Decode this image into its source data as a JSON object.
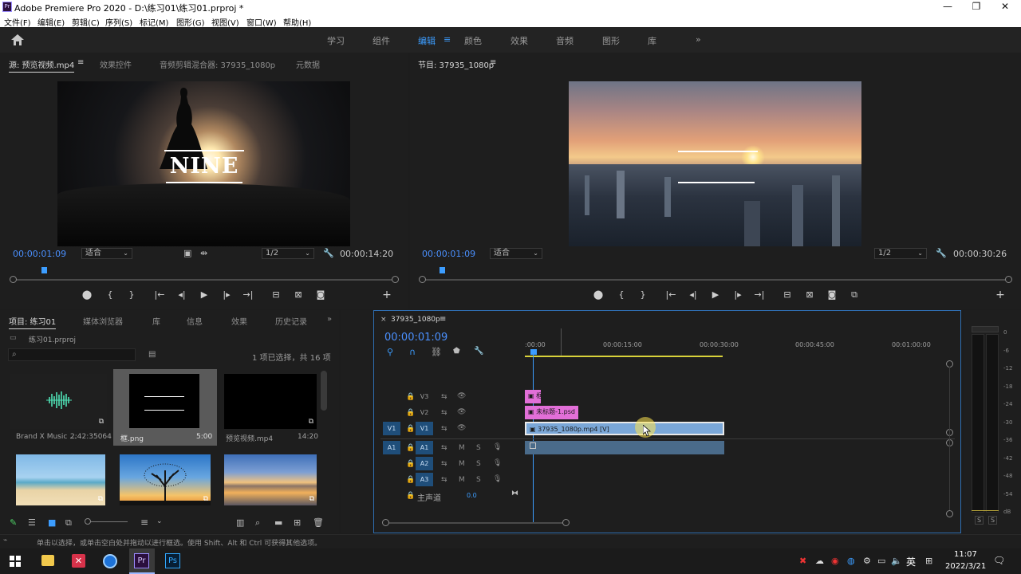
{
  "window": {
    "title": "Adobe Premiere Pro 2020 - D:\\练习01\\练习01.prproj *",
    "logo_text": "Pr",
    "minimize": "—",
    "restore": "❐",
    "close": "✕"
  },
  "menu": [
    "文件(F)",
    "编辑(E)",
    "剪辑(C)",
    "序列(S)",
    "标记(M)",
    "图形(G)",
    "视图(V)",
    "窗口(W)",
    "帮助(H)"
  ],
  "workspaces": {
    "items": [
      "学习",
      "组件",
      "编辑",
      "颜色",
      "效果",
      "音频",
      "图形",
      "库"
    ],
    "active": "编辑",
    "menu_icon": "≡",
    "more": "»"
  },
  "source_panel": {
    "tabs": [
      "源: 预览视频.mp4",
      "效果控件",
      "音频剪辑混合器: 37935_1080p",
      "元数据"
    ],
    "menu_icon": "≡",
    "overlay_text": "NINE",
    "timecode": "00:00:01:09",
    "fit": "适合",
    "resolution": "1/2",
    "duration": "00:00:14:20"
  },
  "program_panel": {
    "tab": "节目: 37935_1080p",
    "menu_icon": "≡",
    "timecode": "00:00:01:09",
    "fit": "适合",
    "resolution": "1/2",
    "duration": "00:00:30:26"
  },
  "transport": {
    "marker": "⬤",
    "in": "{",
    "out": "}",
    "goto_in": "|←",
    "step_back": "◂|",
    "play": "▶",
    "step_fwd": "|▸",
    "goto_out": "→|",
    "insert": "⊟",
    "overwrite": "⊠",
    "export_frame": "◙",
    "compare": "⧉",
    "add": "+"
  },
  "project_panel": {
    "tabs": [
      "项目: 练习01",
      "媒体浏览器",
      "库",
      "信息",
      "效果",
      "历史记录"
    ],
    "project_file": "练习01.prproj",
    "selection_info": "1 项已选择，共 16 项",
    "more": "»",
    "items": [
      {
        "name": "Brand X Music ...",
        "duration": "2:42:35064",
        "kind": "audio"
      },
      {
        "name": "框.png",
        "duration": "5:00",
        "kind": "frame"
      },
      {
        "name": "预览视频.mp4",
        "duration": "14:20",
        "kind": "black"
      },
      {
        "name": "",
        "duration": "",
        "kind": "beach"
      },
      {
        "name": "",
        "duration": "",
        "kind": "tree"
      },
      {
        "name": "",
        "duration": "",
        "kind": "lake"
      }
    ]
  },
  "timeline": {
    "tab": "37935_1080p",
    "close": "×",
    "menu_icon": "≡",
    "timecode": "00:00:01:09",
    "ruler": [
      ":00:00",
      "00:00:15:00",
      "00:00:30:00",
      "00:00:45:00",
      "00:01:00:00"
    ],
    "video_tracks": [
      {
        "name": "V3",
        "source": ""
      },
      {
        "name": "V2",
        "source": ""
      },
      {
        "name": "V1",
        "source": "V1"
      }
    ],
    "audio_tracks": [
      {
        "name": "A1",
        "source": "A1"
      },
      {
        "name": "A2",
        "source": ""
      },
      {
        "name": "A3",
        "source": ""
      }
    ],
    "track_m": "M",
    "track_s": "S",
    "master_label": "主声道",
    "master_value": "0.0",
    "clips": {
      "v3": {
        "label": "框",
        "color": "#e26fd8",
        "duration_s": 2.5
      },
      "v2": {
        "label": "未标题-1.psd",
        "color": "#e26fd8",
        "duration_s": 8.3
      },
      "v1": {
        "label": "37935_1080p.mp4 [V]",
        "color": "#7aa7d8",
        "duration_s": 31
      },
      "a1": {
        "color": "#4a6b8a",
        "duration_s": 31
      }
    }
  },
  "meter": {
    "ticks": [
      "0",
      "-6",
      "-12",
      "-18",
      "-24",
      "-30",
      "-36",
      "-42",
      "-48",
      "-54",
      "dB"
    ],
    "solo": "S"
  },
  "status_bar": {
    "text": "单击以选择，或单击空白处并拖动以进行框选。使用 Shift、Alt 和 Ctrl 可获得其他选项。"
  },
  "taskbar": {
    "ime": "英",
    "time": "11:07",
    "date": "2022/3/21",
    "notifications": "🗨"
  },
  "colors": {
    "accent": "#3c9dff",
    "panel": "#1e1e1e",
    "selection_border": "#2f6fb3"
  }
}
